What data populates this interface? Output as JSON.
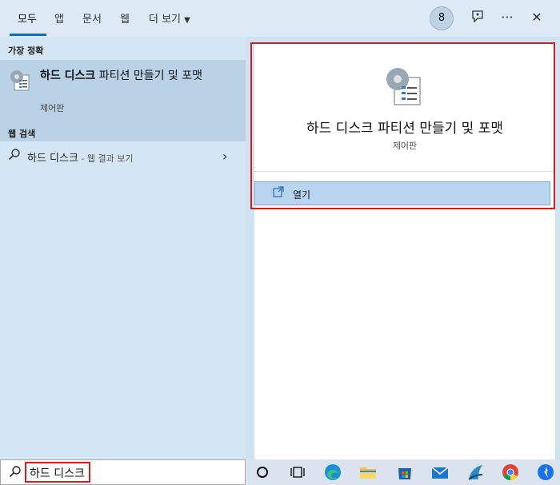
{
  "tabs": [
    {
      "label": "모두",
      "active": true
    },
    {
      "label": "앱"
    },
    {
      "label": "문서"
    },
    {
      "label": "웹"
    },
    {
      "label": "더 보기"
    }
  ],
  "header": {
    "badge_count": "8",
    "icons": [
      "feedback-icon",
      "more-icon",
      "close-icon"
    ]
  },
  "left": {
    "best_match_label": "가장 정확",
    "best_match": {
      "title_bold": "하드 디스크",
      "title_rest": " 파티션 만들기 및 포맷",
      "subtitle": "제어판"
    },
    "web_search_label": "웹 검색",
    "web_item": {
      "query": "하드 디스크",
      "suffix": " - 웹 결과 보기"
    }
  },
  "detail": {
    "title": "하드 디스크 파티션 만들기 및 포맷",
    "subtitle": "제어판",
    "open_label": "열기"
  },
  "search": {
    "value": "하드 디스크"
  },
  "taskbar": {
    "icons": [
      "cortana-icon",
      "task-view-icon",
      "edge-icon",
      "file-explorer-icon",
      "store-icon",
      "mail-icon",
      "app-icon",
      "chrome-icon",
      "app-blue-icon"
    ]
  },
  "colors": {
    "accent": "#0a6cc7",
    "highlight": "#d01d21",
    "selection": "#b9d2e6"
  }
}
